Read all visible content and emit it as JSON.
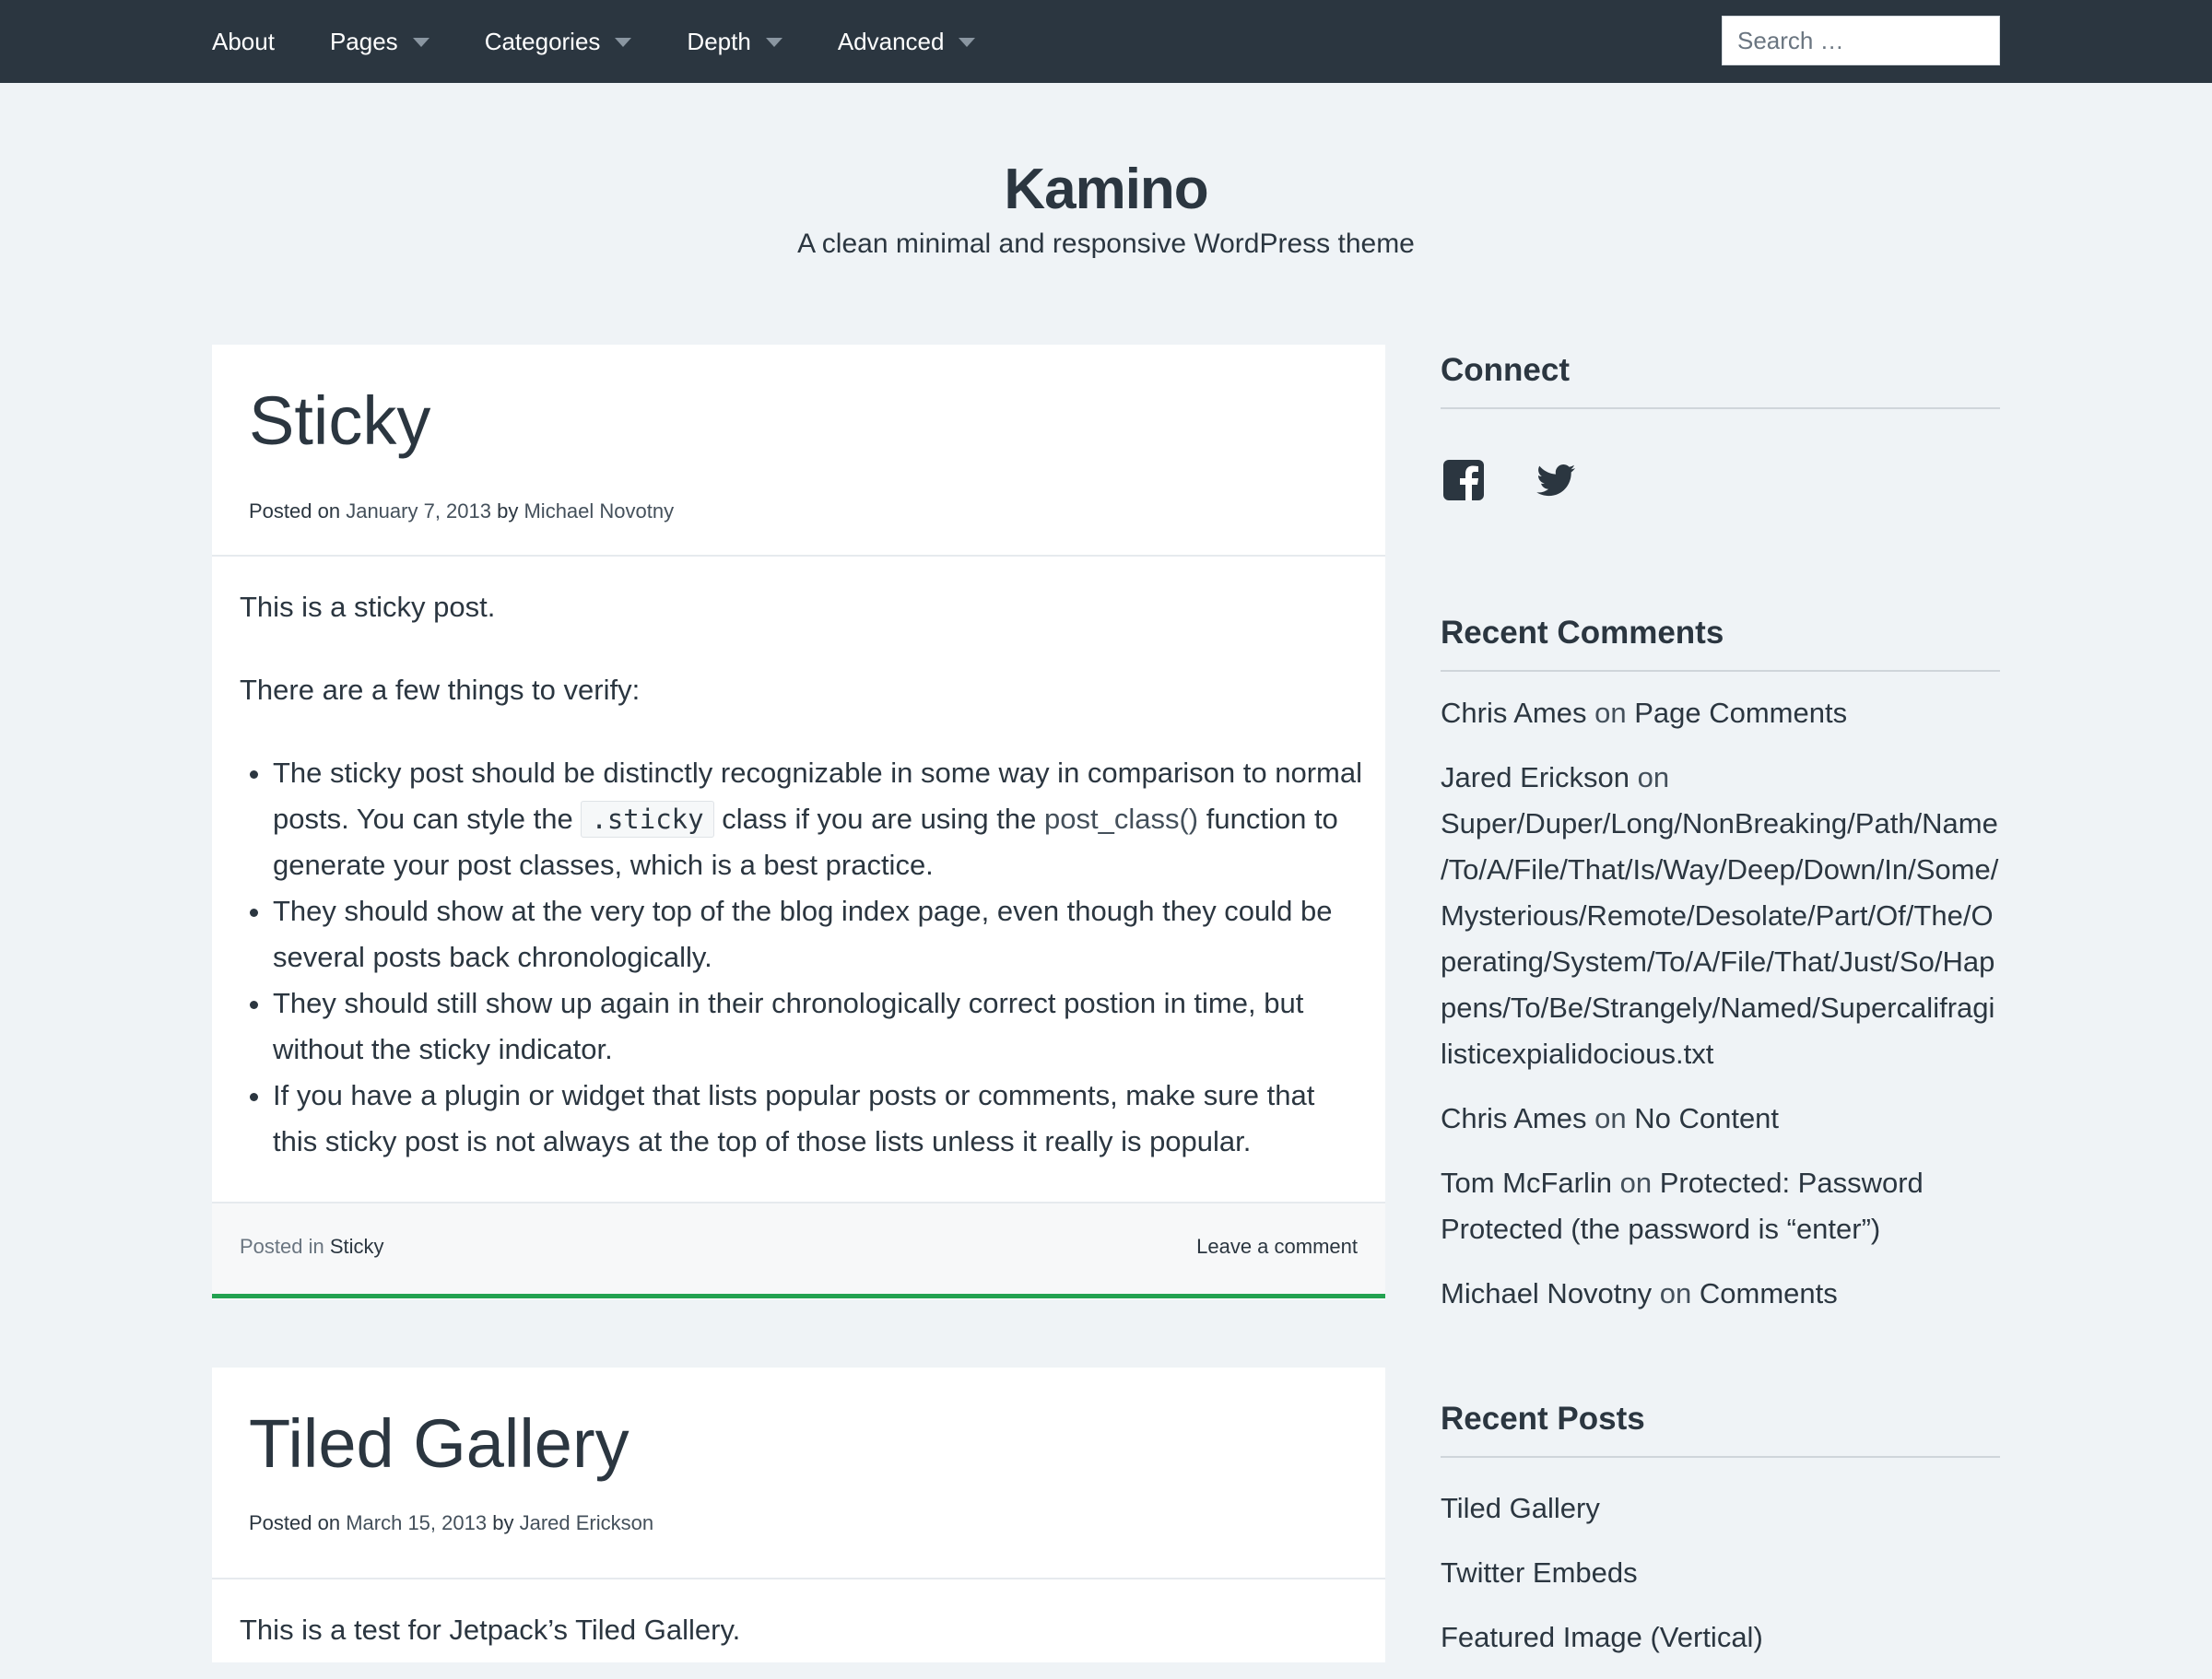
{
  "nav": {
    "items": [
      {
        "label": "About",
        "has_caret": false
      },
      {
        "label": "Pages",
        "has_caret": true
      },
      {
        "label": "Categories",
        "has_caret": true
      },
      {
        "label": "Depth",
        "has_caret": true
      },
      {
        "label": "Advanced",
        "has_caret": true
      }
    ],
    "search_placeholder": "Search …"
  },
  "site": {
    "title": "Kamino",
    "description": "A clean minimal and responsive WordPress theme"
  },
  "posts": [
    {
      "title": "Sticky",
      "meta_prefix": "Posted on",
      "date": "January 7, 2013",
      "meta_by": "by",
      "author": "Michael Novotny",
      "p1": "This is a sticky post.",
      "p2": "There are a few things to verify:",
      "li1_a": "The sticky post should be distinctly recognizable in some way in comparison to normal posts. You can style the",
      "li1_code": ".sticky",
      "li1_b": "class if you are using the",
      "li1_link": "post_class()",
      "li1_c": "function to generate your post classes, which is a best practice.",
      "li2": "They should show at the very top of the blog index page, even though they could be several posts back chronologically.",
      "li3": "They should still show up again in their chronologically correct postion in time, but without the sticky indicator.",
      "li4": "If you have a plugin or widget that lists popular posts or comments, make sure that this sticky post is not always at the top of those lists unless it really is popular.",
      "posted_in": "Posted in",
      "category": "Sticky",
      "comment_link": "Leave a comment"
    },
    {
      "title": "Tiled Gallery",
      "meta_prefix": "Posted on",
      "date": "March 15, 2013",
      "meta_by": "by",
      "author": "Jared Erickson",
      "p1": "This is a test for Jetpack’s Tiled Gallery."
    }
  ],
  "sidebar": {
    "connect": {
      "title": "Connect",
      "icons": [
        "facebook-icon",
        "twitter-icon"
      ]
    },
    "recent_comments": {
      "title": "Recent Comments",
      "items": [
        {
          "author": "Chris Ames",
          "on": "on",
          "post": "Page Comments"
        },
        {
          "author": "Jared Erickson",
          "on": "on",
          "post": "Super/Duper/Long/NonBreaking/Path/Name/To/A/File/That/Is/Way/Deep/Down/In/Some/Mysterious/Remote/Desolate/Part/Of/The/Operating/System/To/A/File/That/Just/So/Happens/To/Be/Strangely/Named/Supercalifragilisticexpialidocious.txt"
        },
        {
          "author": "Chris Ames",
          "on": "on",
          "post": "No Content"
        },
        {
          "author": "Tom McFarlin",
          "on": "on",
          "post": "Protected: Password Protected (the password is “enter”)"
        },
        {
          "author": "Michael Novotny",
          "on": "on",
          "post": "Comments"
        }
      ]
    },
    "recent_posts": {
      "title": "Recent Posts",
      "items": [
        "Tiled Gallery",
        "Twitter Embeds",
        "Featured Image (Vertical)"
      ]
    }
  },
  "colors": {
    "nav_bg": "#2b3640",
    "page_bg": "#eff3f6",
    "sticky_accent": "#23a251"
  }
}
